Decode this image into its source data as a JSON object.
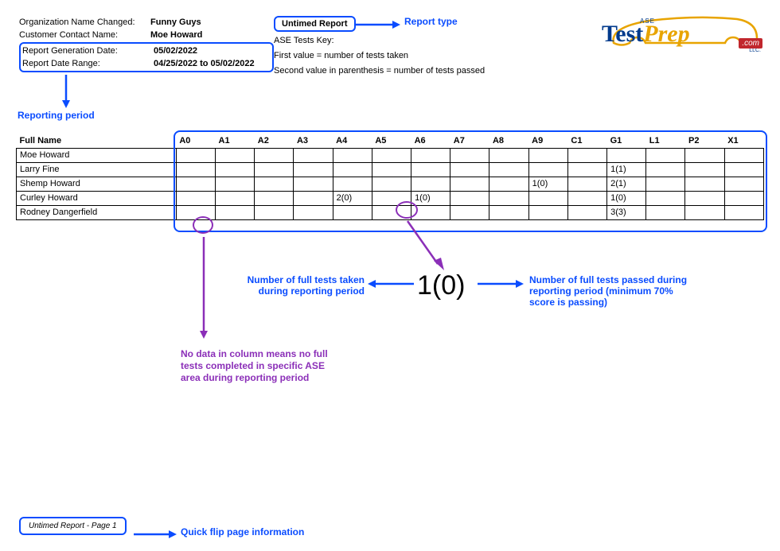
{
  "meta": {
    "orgLabel": "Organization Name Changed:",
    "orgValue": "Funny Guys",
    "contactLabel": "Customer Contact Name:",
    "contactValue": "Moe Howard",
    "genLabel": "Report Generation Date:",
    "genValue": "05/02/2022",
    "rangeLabel": "Report Date Range:",
    "rangeValue": "04/25/2022 to 05/02/2022"
  },
  "reportType": "Untimed Report",
  "key": {
    "title": "ASE Tests Key:",
    "line1": "First value = number of tests taken",
    "line2": "Second value in parenthesis = number of tests passed"
  },
  "logo": {
    "ase": "ASE",
    "test": "Test",
    "prep": "Prep",
    "llc": "LLC.",
    "com": ".com"
  },
  "annotations": {
    "reportType": "Report type",
    "reportingPeriod": "Reporting period",
    "taken": "Number of full tests taken during reporting period",
    "passed": "Number of full tests passed during reporting period (minimum 70% score is passing)",
    "noData": "No data in column means no full tests completed in specific ASE area during reporting period",
    "footer": "Quick flip page information",
    "bigValue": "1(0)"
  },
  "table": {
    "fullNameHeader": "Full Name",
    "columns": [
      "A0",
      "A1",
      "A2",
      "A3",
      "A4",
      "A5",
      "A6",
      "A7",
      "A8",
      "A9",
      "C1",
      "G1",
      "L1",
      "P2",
      "X1"
    ],
    "rows": [
      {
        "name": "Moe Howard",
        "cells": [
          "",
          "",
          "",
          "",
          "",
          "",
          "",
          "",
          "",
          "",
          "",
          "",
          "",
          "",
          ""
        ]
      },
      {
        "name": "Larry Fine",
        "cells": [
          "",
          "",
          "",
          "",
          "",
          "",
          "",
          "",
          "",
          "",
          "",
          "1(1)",
          "",
          "",
          ""
        ]
      },
      {
        "name": "Shemp Howard",
        "cells": [
          "",
          "",
          "",
          "",
          "",
          "",
          "",
          "",
          "",
          "1(0)",
          "",
          "2(1)",
          "",
          "",
          ""
        ]
      },
      {
        "name": "Curley Howard",
        "cells": [
          "",
          "",
          "",
          "",
          "2(0)",
          "",
          "1(0)",
          "",
          "",
          "",
          "",
          "1(0)",
          "",
          "",
          ""
        ]
      },
      {
        "name": "Rodney Dangerfield",
        "cells": [
          "",
          "",
          "",
          "",
          "",
          "",
          "",
          "",
          "",
          "",
          "",
          "3(3)",
          "",
          "",
          ""
        ]
      }
    ]
  },
  "footer": "Untimed Report - Page 1",
  "chart_data": {
    "type": "table",
    "title": "Untimed Report — tests taken(passed) by ASE area",
    "columns": [
      "A0",
      "A1",
      "A2",
      "A3",
      "A4",
      "A5",
      "A6",
      "A7",
      "A8",
      "A9",
      "C1",
      "G1",
      "L1",
      "P2",
      "X1"
    ],
    "rows": [
      {
        "name": "Moe Howard",
        "values": [
          null,
          null,
          null,
          null,
          null,
          null,
          null,
          null,
          null,
          null,
          null,
          null,
          null,
          null,
          null
        ]
      },
      {
        "name": "Larry Fine",
        "values": [
          null,
          null,
          null,
          null,
          null,
          null,
          null,
          null,
          null,
          null,
          null,
          {
            "taken": 1,
            "passed": 1
          },
          null,
          null,
          null
        ]
      },
      {
        "name": "Shemp Howard",
        "values": [
          null,
          null,
          null,
          null,
          null,
          null,
          null,
          null,
          null,
          {
            "taken": 1,
            "passed": 0
          },
          null,
          {
            "taken": 2,
            "passed": 1
          },
          null,
          null,
          null
        ]
      },
      {
        "name": "Curley Howard",
        "values": [
          null,
          null,
          null,
          null,
          {
            "taken": 2,
            "passed": 0
          },
          null,
          {
            "taken": 1,
            "passed": 0
          },
          null,
          null,
          null,
          null,
          {
            "taken": 1,
            "passed": 0
          },
          null,
          null,
          null
        ]
      },
      {
        "name": "Rodney Dangerfield",
        "values": [
          null,
          null,
          null,
          null,
          null,
          null,
          null,
          null,
          null,
          null,
          null,
          {
            "taken": 3,
            "passed": 3
          },
          null,
          null,
          null
        ]
      }
    ]
  }
}
